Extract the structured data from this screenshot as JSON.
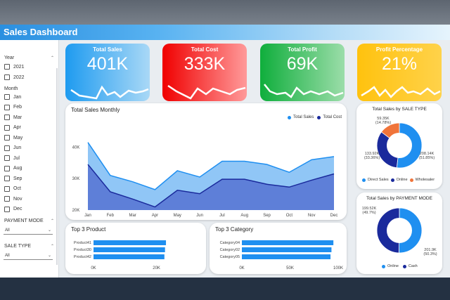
{
  "header": {
    "title": "Sales Dashboard"
  },
  "filters": {
    "year_label": "Year",
    "years": [
      "2021",
      "2022"
    ],
    "month_label": "Month",
    "months": [
      "Jan",
      "Feb",
      "Mar",
      "Apr",
      "May",
      "Jun",
      "Jul",
      "Aug",
      "Sep",
      "Oct",
      "Nov",
      "Dec"
    ],
    "payment_mode_label": "PAYMENT MODE",
    "payment_mode_value": "All",
    "sale_type_label": "SALE TYPE",
    "sale_type_value": "All"
  },
  "kpis": [
    {
      "title": "Total Sales",
      "value": "401K",
      "color_from": "#1e9bf0",
      "color_to": "#a9d8f6"
    },
    {
      "title": "Total Cost",
      "value": "333K",
      "color_from": "#f00000",
      "color_to": "#ff9a9a"
    },
    {
      "title": "Total Profit",
      "value": "69K",
      "color_from": "#0fae3c",
      "color_to": "#9bdda9"
    },
    {
      "title": "Profit Percentage",
      "value": "21%",
      "color_from": "#ffc20e",
      "color_to": "#ffd24a"
    }
  ],
  "monthly": {
    "title": "Total Sales Monthly",
    "legend": [
      "Total Sales",
      "Total Cost"
    ]
  },
  "top_product": {
    "title": "Top 3 Product"
  },
  "top_category": {
    "title": "Top 3 Category"
  },
  "sale_type": {
    "title": "Total Sales by SALE TYPE",
    "labels": {
      "top_value": "59.35K",
      "top_pct": "(14.78%)",
      "left_value": "133.92K",
      "left_pct": "(33.36%)",
      "right_value": "208.14K",
      "right_pct": "(51.85%)"
    },
    "legend": [
      "Direct Sales",
      "Online",
      "Wholesaler"
    ]
  },
  "payment_mode": {
    "title": "Total Sales by PAYMENT MODE",
    "labels": {
      "left_value": "199.52K",
      "left_pct": "(49.7%)",
      "right_value": "201.9K",
      "right_pct": "(50.3%)"
    },
    "legend": [
      "Online",
      "Cash"
    ]
  },
  "colors": {
    "light_blue": "#1f8ff0",
    "dark_blue": "#1a2a9c",
    "orange": "#f0743a",
    "area_light": "#90c6f6",
    "area_dark": "#5e7fd8"
  },
  "chart_data": [
    {
      "type": "area",
      "title": "Total Sales Monthly",
      "x": [
        "Jan",
        "Feb",
        "Mar",
        "Apr",
        "May",
        "Jun",
        "Jul",
        "Aug",
        "Sep",
        "Oct",
        "Nov",
        "Dec"
      ],
      "ylim": [
        20000,
        45000
      ],
      "yticks": [
        "20K",
        "30K",
        "40K"
      ],
      "series": [
        {
          "name": "Total Sales",
          "values": [
            41500,
            31000,
            29000,
            26500,
            32500,
            30500,
            35500,
            35500,
            34500,
            32000,
            36000,
            37000
          ]
        },
        {
          "name": "Total Cost",
          "values": [
            34500,
            25800,
            23500,
            21000,
            26300,
            25200,
            29800,
            29800,
            28200,
            27300,
            29500,
            31500
          ]
        }
      ]
    },
    {
      "type": "bar",
      "title": "Top 3 Product",
      "categories": [
        "Product41",
        "Product30",
        "Product42"
      ],
      "values": [
        23000,
        22700,
        22500
      ],
      "xlim": [
        0,
        25000
      ],
      "xticks": [
        "0K",
        "20K"
      ]
    },
    {
      "type": "bar",
      "title": "Top 3 Category",
      "categories": [
        "Category04",
        "Category02",
        "Category05"
      ],
      "values": [
        95000,
        93000,
        92000
      ],
      "xlim": [
        0,
        100000
      ],
      "xticks": [
        "0K",
        "50K",
        "100K"
      ]
    },
    {
      "type": "pie",
      "title": "Total Sales by SALE TYPE",
      "categories": [
        "Direct Sales",
        "Online",
        "Wholesaler"
      ],
      "values": [
        208140,
        133920,
        59350
      ]
    },
    {
      "type": "pie",
      "title": "Total Sales by PAYMENT MODE",
      "categories": [
        "Online",
        "Cash"
      ],
      "values": [
        201900,
        199520
      ]
    }
  ]
}
